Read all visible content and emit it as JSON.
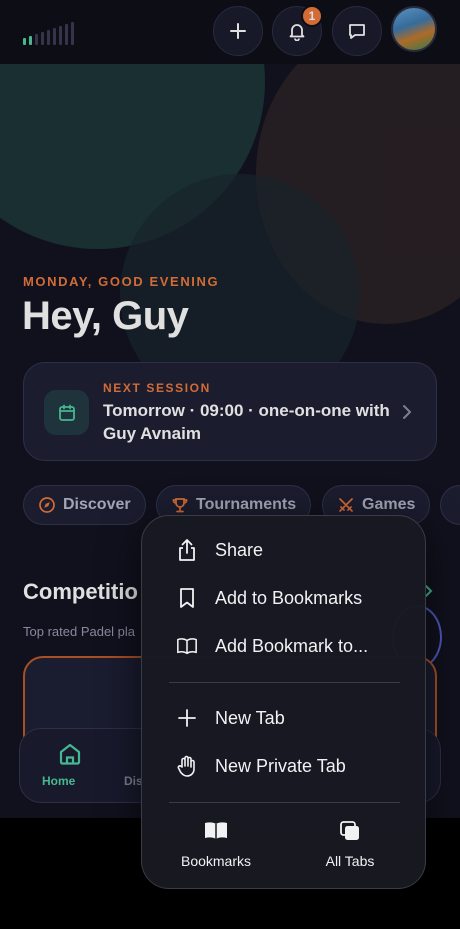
{
  "header": {
    "notifications_count": "1",
    "icons": [
      "signal-strength-icon",
      "plus-icon",
      "bell-icon",
      "chat-icon"
    ]
  },
  "hero": {
    "greeting": "MONDAY, GOOD EVENING",
    "title": "Hey, Guy"
  },
  "next_session": {
    "label": "NEXT SESSION",
    "text": "Tomorrow · 09:00 · one-on-one with Guy Avnaim"
  },
  "chips": [
    {
      "label": "Discover",
      "icon": "compass-icon"
    },
    {
      "label": "Tournaments",
      "icon": "trophy-icon"
    },
    {
      "label": "Games",
      "icon": "swords-icon"
    }
  ],
  "competitions": {
    "title": "Competitio",
    "subtitle": "Top rated Padel pla"
  },
  "tabbar": {
    "home_label": "Home",
    "discover_label": "Dis"
  },
  "context_menu": {
    "items": [
      {
        "label": "Share",
        "icon": "share-icon"
      },
      {
        "label": "Add to Bookmarks",
        "icon": "bookmark-icon"
      },
      {
        "label": "Add Bookmark to...",
        "icon": "open-book-icon"
      },
      {
        "label": "New Tab",
        "icon": "plus-icon"
      },
      {
        "label": "New Private Tab",
        "icon": "hand-icon"
      }
    ],
    "bottom": [
      {
        "label": "Bookmarks",
        "icon": "bookmarks-book-icon"
      },
      {
        "label": "All Tabs",
        "icon": "tabs-icon"
      }
    ]
  },
  "colors": {
    "accent_orange": "#ef7a3e",
    "accent_green": "#4fd1a5",
    "background": "#131422"
  }
}
